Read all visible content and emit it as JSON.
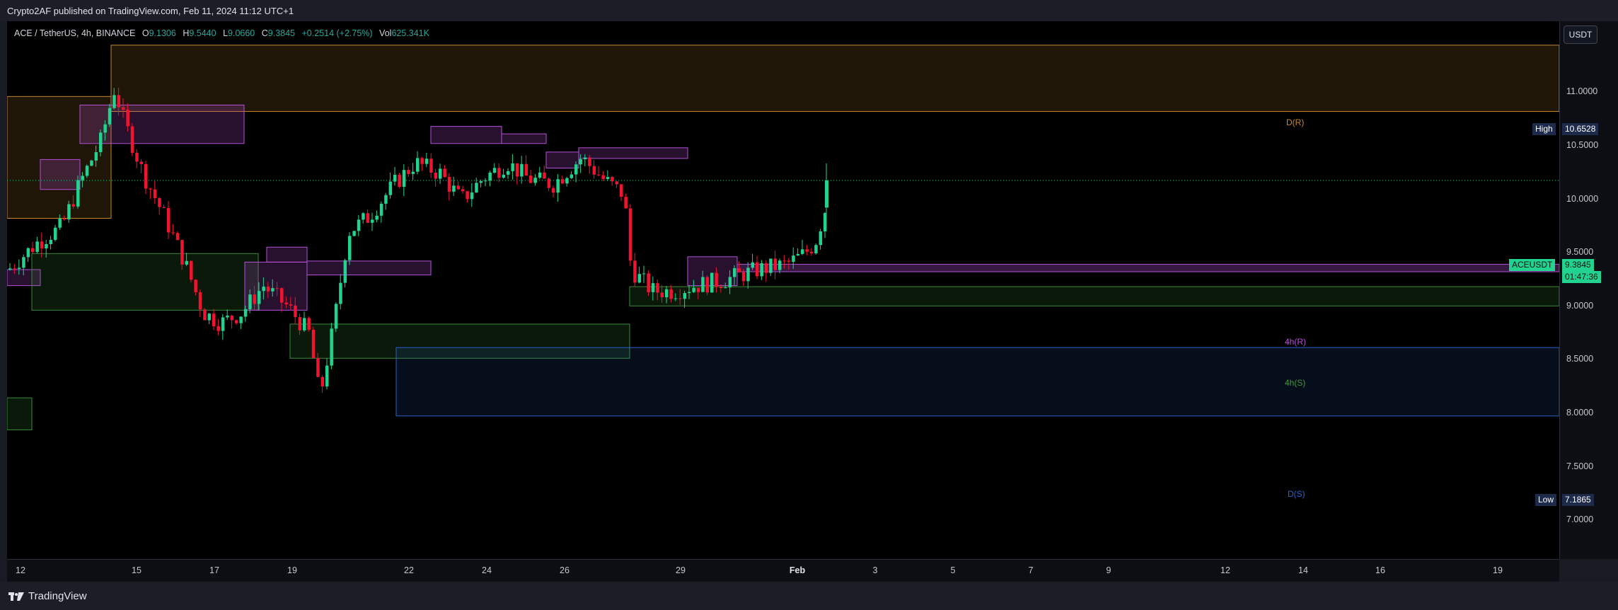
{
  "header": {
    "published": "Crypto2AF published on TradingView.com, Feb 11, 2024 11:12 UTC+1"
  },
  "legend": {
    "symbol": "ACE / TetherUS, 4h, BINANCE",
    "o_label": "O",
    "o_value": "9.1306",
    "h_label": "H",
    "h_value": "9.5440",
    "l_label": "L",
    "l_value": "9.0660",
    "c_label": "C",
    "c_value": "9.3845",
    "change": "+0.2514 (+2.75%)",
    "vol_label": "Vol",
    "vol_value": "625.341K"
  },
  "currency_button": "USDT",
  "price_axis": {
    "ticks": [
      "11.0000",
      "10.5000",
      "10.0000",
      "9.5000",
      "9.0000",
      "8.5000",
      "8.0000",
      "7.5000",
      "7.0000"
    ],
    "high_label": "High",
    "high_value": "10.6528",
    "low_label": "Low",
    "low_value": "7.1865",
    "symbol_tag": "ACEUSDT",
    "last_price": "9.3845",
    "countdown": "01:47:36"
  },
  "time_axis": {
    "ticks": [
      "12",
      "15",
      "17",
      "19",
      "22",
      "24",
      "26",
      "29",
      "Feb",
      "3",
      "5",
      "7",
      "9",
      "12",
      "14",
      "16",
      "19"
    ]
  },
  "zone_labels": {
    "daily_resistance": "D(R)",
    "h4_resistance": "4h(R)",
    "h4_support": "4h(S)",
    "daily_support": "D(S)"
  },
  "colors": {
    "up": "#26a69a",
    "up_bright": "#22d38f",
    "down": "#f0142f",
    "daily_res": "#c8862c",
    "h4_res": "#b44fd6",
    "h4_sup": "#3a8a3a",
    "daily_sup": "#2a62c9"
  },
  "footer": {
    "brand": "TradingView"
  }
}
